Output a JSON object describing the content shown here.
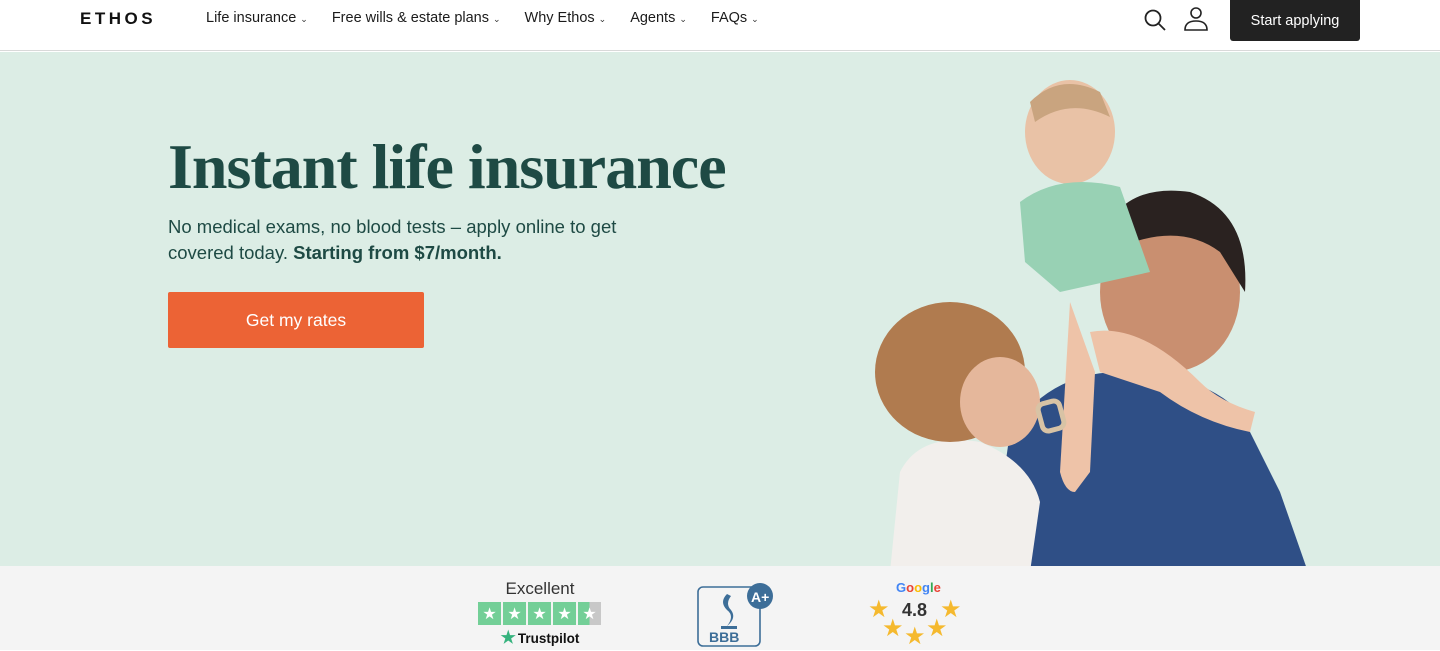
{
  "nav": {
    "logo": "ETHOS",
    "menu": [
      {
        "label": "Life insurance"
      },
      {
        "label": "Free wills & estate plans"
      },
      {
        "label": "Why Ethos"
      },
      {
        "label": "Agents"
      },
      {
        "label": "FAQs"
      }
    ],
    "chevron": "⌄",
    "start_label": "Start applying"
  },
  "hero": {
    "title": "Instant life insurance",
    "subtitle": "No medical exams, no blood tests – apply online to get covered today.",
    "subtitle_bold": "Starting from $7/month.",
    "cta_label": "Get my rates",
    "image_alt": "Family photo: mother kissing father with baby on his shoulders"
  },
  "trust": {
    "trustpilot": {
      "label": "Excellent",
      "brand": "Trustpilot",
      "stars": 4.5
    },
    "bbb": {
      "label": "BBB",
      "rating": "A+"
    },
    "google": {
      "brand": "Google",
      "score": "4.8"
    }
  },
  "colors": {
    "brand_green": "#1e4a44",
    "hero_bg": "#dcede5",
    "cta_orange": "#ec6335",
    "trustpilot_green": "#73cf97",
    "bbb_blue": "#3d6e98",
    "google_star": "#f5b92e"
  }
}
